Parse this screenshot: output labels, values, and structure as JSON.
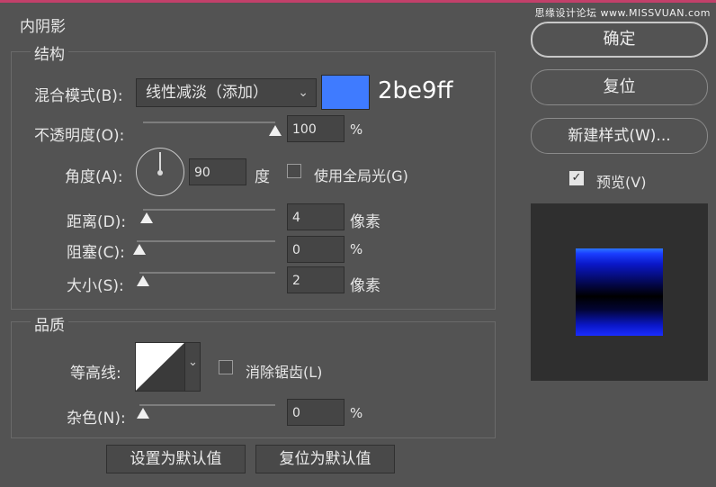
{
  "watermark": "思缘设计论坛 www.MISSVUAN.com",
  "panel_title": "内阴影",
  "structure": {
    "title": "结构",
    "blend_mode_label": "混合模式(B):",
    "blend_mode_value": "线性减淡（添加）",
    "color_hex_label": "2be9ff",
    "swatch_color": "#3f7bff",
    "opacity_label": "不透明度(O):",
    "opacity_value": "100",
    "opacity_level": 1.0,
    "opacity_unit": "%",
    "angle_label": "角度(A):",
    "angle_value": "90",
    "angle_unit": "度",
    "global_light_label": "使用全局光(G)",
    "global_light_checked": false,
    "distance_label": "距离(D):",
    "distance_value": "4",
    "distance_unit": "像素",
    "choke_label": "阻塞(C):",
    "choke_value": "0",
    "choke_unit": "%",
    "size_label": "大小(S):",
    "size_value": "2",
    "size_unit": "像素"
  },
  "quality": {
    "title": "品质",
    "contour_label": "等高线:",
    "anti_alias_label": "消除锯齿(L)",
    "anti_alias_checked": false,
    "noise_label": "杂色(N):",
    "noise_value": "0",
    "noise_unit": "%"
  },
  "buttons": {
    "make_default": "设置为默认值",
    "reset_default": "复位为默认值",
    "ok": "确定",
    "reset": "复位",
    "new_style": "新建样式(W)...",
    "preview_label": "预览(V)",
    "preview_checked": true
  }
}
